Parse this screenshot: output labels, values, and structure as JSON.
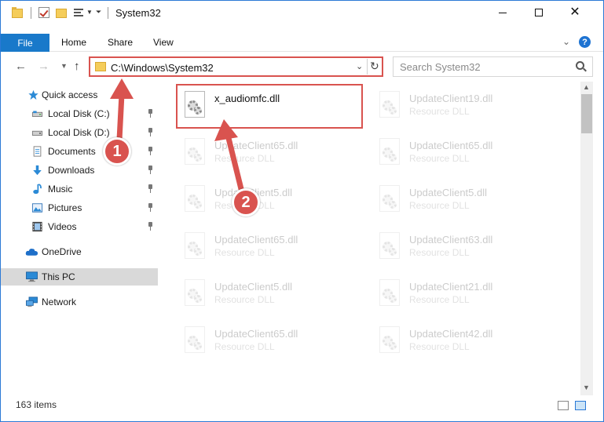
{
  "window": {
    "title": "System32"
  },
  "ribbon": {
    "file_label": "File",
    "home_label": "Home",
    "share_label": "Share",
    "view_label": "View",
    "help_label": "?"
  },
  "address": {
    "path": "C:\\Windows\\System32",
    "search_placeholder": "Search System32"
  },
  "sidebar": {
    "items": [
      {
        "label": "Quick access",
        "icon": "star-icon"
      },
      {
        "label": "Local Disk (C:)",
        "icon": "drive-icon",
        "pinned": true
      },
      {
        "label": "Local Disk (D:)",
        "icon": "drive-icon",
        "pinned": true
      },
      {
        "label": "Documents",
        "icon": "documents-icon",
        "pinned": true
      },
      {
        "label": "Downloads",
        "icon": "download-icon",
        "pinned": true
      },
      {
        "label": "Music",
        "icon": "music-icon",
        "pinned": true
      },
      {
        "label": "Pictures",
        "icon": "pictures-icon",
        "pinned": true
      },
      {
        "label": "Videos",
        "icon": "videos-icon",
        "pinned": true
      },
      {
        "label": "OneDrive",
        "icon": "cloud-icon"
      },
      {
        "label": "This PC",
        "icon": "computer-icon",
        "selected": true
      },
      {
        "label": "Network",
        "icon": "network-icon"
      }
    ]
  },
  "files": {
    "left_column": [
      {
        "name": "x_audiomfc.dll",
        "type": ""
      },
      {
        "name": "UpdateClient65.dll",
        "type": "Resource DLL"
      },
      {
        "name": "UpdateClient5.dll",
        "type": "Resource DLL"
      },
      {
        "name": "UpdateClient65.dll",
        "type": "Resource DLL"
      },
      {
        "name": "UpdateClient5.dll",
        "type": "Resource DLL"
      },
      {
        "name": "UpdateClient65.dll",
        "type": "Resource DLL"
      }
    ],
    "right_column": [
      {
        "name": "UpdateClient19.dll",
        "type": "Resource DLL"
      },
      {
        "name": "UpdateClient65.dll",
        "type": "Resource DLL"
      },
      {
        "name": "UpdateClient5.dll",
        "type": "Resource DLL"
      },
      {
        "name": "UpdateClient63.dll",
        "type": "Resource DLL"
      },
      {
        "name": "UpdateClient21.dll",
        "type": "Resource DLL"
      },
      {
        "name": "UpdateClient42.dll",
        "type": "Resource DLL"
      }
    ]
  },
  "status": {
    "count": "163 items"
  },
  "annotations": {
    "step1": "1",
    "step2": "2",
    "color": "#d9534f"
  }
}
